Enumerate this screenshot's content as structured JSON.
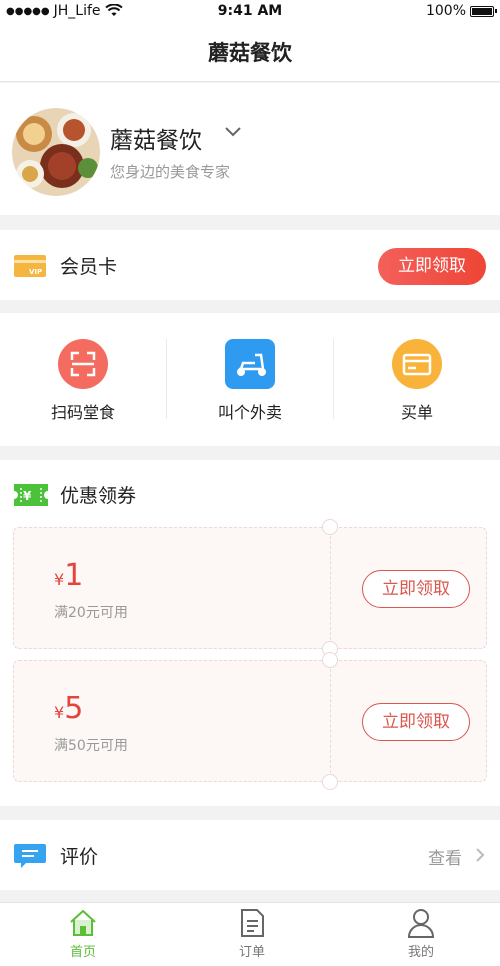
{
  "status_bar": {
    "carrier": "JH_Life",
    "time": "9:41 AM",
    "battery": "100%"
  },
  "nav": {
    "title": "蘑菇餐饮"
  },
  "shop": {
    "name": "蘑菇餐饮",
    "slogan": "您身边的美食专家"
  },
  "member": {
    "label": "会员卡",
    "button": "立即领取"
  },
  "services": [
    {
      "label": "扫码堂食",
      "icon": "scan-icon",
      "color": "#f36c5f"
    },
    {
      "label": "叫个外卖",
      "icon": "scooter-icon",
      "color": "#2f9bf0"
    },
    {
      "label": "买单",
      "icon": "card-icon",
      "color": "#f9b23a"
    }
  ],
  "coupons": {
    "title": "优惠领券",
    "items": [
      {
        "currency": "¥",
        "amount": "1",
        "condition": "满20元可用",
        "button": "立即领取"
      },
      {
        "currency": "¥",
        "amount": "5",
        "condition": "满50元可用",
        "button": "立即领取"
      }
    ]
  },
  "review": {
    "label": "评价",
    "link": "查看"
  },
  "tabs": [
    {
      "label": "首页",
      "icon": "home-icon",
      "active": true
    },
    {
      "label": "订单",
      "icon": "orders-icon",
      "active": false
    },
    {
      "label": "我的",
      "icon": "profile-icon",
      "active": false
    }
  ],
  "colors": {
    "accent": "#ee4536",
    "tab_active": "#5cbd38",
    "vip": "#f5b640",
    "coupon_green": "#4cc13a",
    "review_blue": "#35a3f0"
  }
}
